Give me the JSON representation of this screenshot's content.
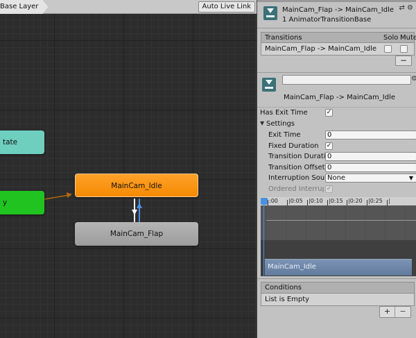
{
  "graph": {
    "breadcrumb": "Base Layer",
    "auto_live_link": "Auto Live Link",
    "states": {
      "teal": "tate",
      "green": "y",
      "idle": "MainCam_Idle",
      "flap": "MainCam_Flap"
    },
    "colors": {
      "idle": "#f58a00",
      "flap": "#a6a6a6",
      "teal": "#6ecfbf",
      "green": "#21c321",
      "selected_transition": "#4a90e0"
    }
  },
  "inspector": {
    "header": {
      "title": "MainCam_Flap -> MainCam_Idle",
      "subtitle": "1 AnimatorTransitionBase",
      "icon": "transition-icon"
    },
    "transitions": {
      "heading": "Transitions",
      "solo": "Solo",
      "mute": "Mute",
      "row": "MainCam_Flap -> MainCam_Idle",
      "remove": "−"
    },
    "selected": {
      "name_value": "",
      "title": "MainCam_Flap -> MainCam_Idle"
    },
    "has_exit_time": {
      "label": "Has Exit Time",
      "checked": "✓"
    },
    "settings": {
      "label": "Settings",
      "exit_time": {
        "label": "Exit Time",
        "value": "0"
      },
      "fixed_duration": {
        "label": "Fixed Duration",
        "checked": "✓"
      },
      "transition_duration": {
        "label": "Transition Duratior",
        "value": "0"
      },
      "transition_offset": {
        "label": "Transition Offset",
        "value": "0"
      },
      "interruption_source": {
        "label": "Interruption Source",
        "value": "None"
      },
      "ordered_interruption": {
        "label": "Ordered Interruptio",
        "checked": "✓"
      }
    },
    "timeline": {
      "ticks": [
        ":00",
        "|0:05",
        "|0:10",
        "|0:15",
        "|0:20",
        "|0:25",
        "|"
      ],
      "clip": "MainCam_Idle"
    },
    "conditions": {
      "heading": "Conditions",
      "empty": "List is Empty",
      "add": "+",
      "remove": "−"
    }
  }
}
